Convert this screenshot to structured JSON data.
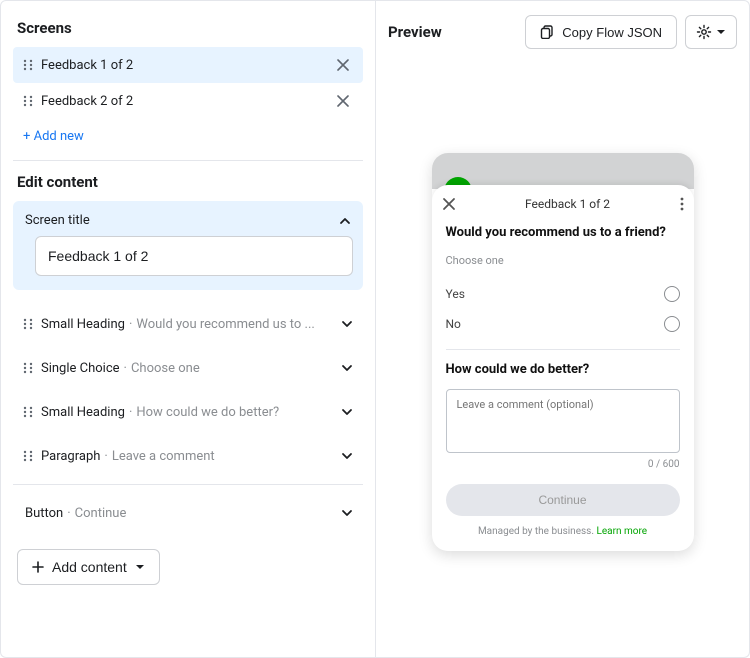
{
  "screens": {
    "heading": "Screens",
    "items": [
      {
        "label": "Feedback 1 of 2",
        "active": true
      },
      {
        "label": "Feedback 2 of 2",
        "active": false
      }
    ],
    "add_new": "+ Add new"
  },
  "edit": {
    "heading": "Edit content",
    "screen_title_label": "Screen title",
    "screen_title_value": "Feedback 1 of 2",
    "items": [
      {
        "kind": "Small Heading",
        "preview": "Would you recommend us to ..."
      },
      {
        "kind": "Single Choice",
        "preview": "Choose one"
      },
      {
        "kind": "Small Heading",
        "preview": "How could we do better?"
      },
      {
        "kind": "Paragraph",
        "preview": "Leave a comment"
      }
    ],
    "button_kind": "Button",
    "button_preview": "Continue",
    "add_content": "Add content"
  },
  "preview": {
    "heading": "Preview",
    "copy_button": "Copy Flow JSON"
  },
  "phone": {
    "title": "Feedback 1 of 2",
    "q1": "Would you recommend us to a friend?",
    "choose_one": "Choose one",
    "opt_yes": "Yes",
    "opt_no": "No",
    "q2": "How could we do better?",
    "comment_placeholder": "Leave a comment (optional)",
    "counter": "0 / 600",
    "continue": "Continue",
    "managed": "Managed by the business. ",
    "learn_more": "Learn more"
  }
}
